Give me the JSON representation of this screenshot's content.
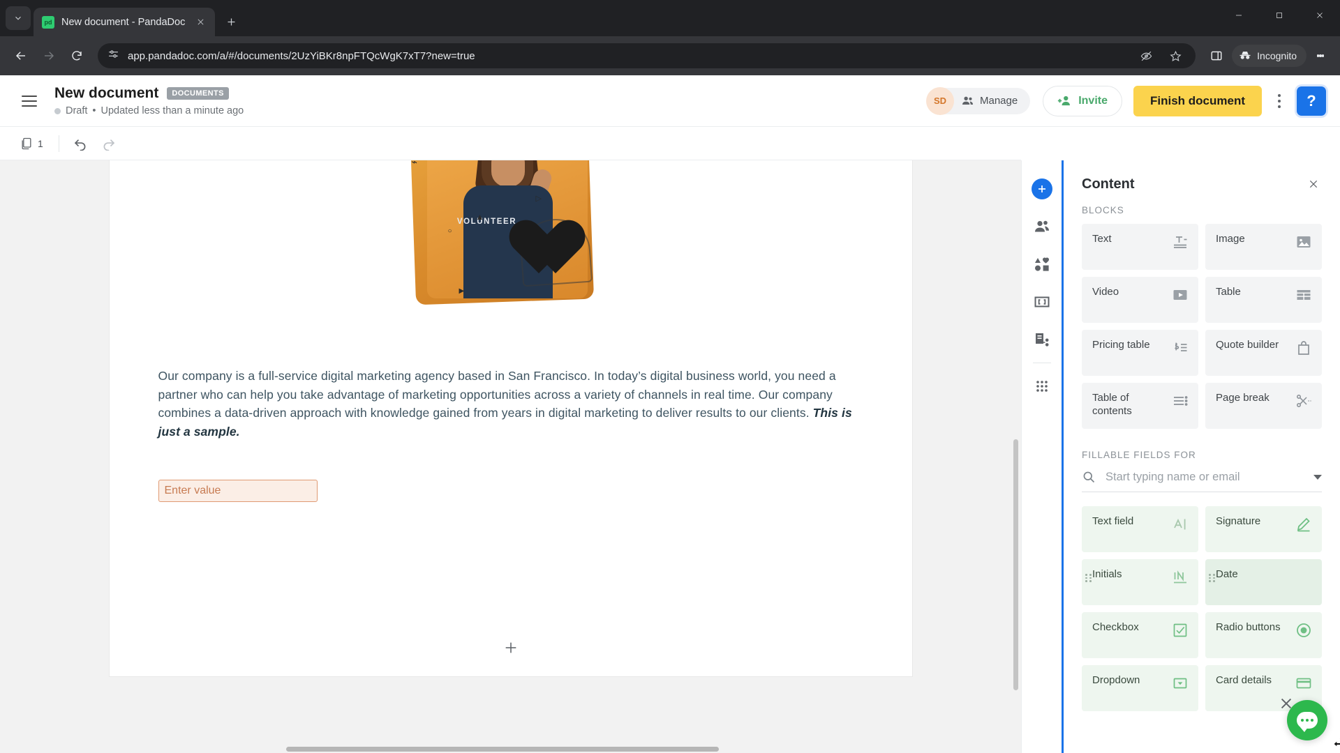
{
  "browser": {
    "tab_title": "New document - PandaDoc",
    "favicon_text": "pd",
    "url": "app.pandadoc.com/a/#/documents/2UzYiBKr8npFTQcWgK7xT7?new=true",
    "profile_label": "Incognito",
    "icons": {
      "tab_search": "chevron-down-icon",
      "close_tab": "close-icon",
      "new_tab": "plus-icon",
      "back": "back-arrow-icon",
      "forward": "forward-arrow-icon",
      "reload": "reload-icon",
      "site_settings": "site-settings-icon",
      "tracking": "eye-off-icon",
      "bookmark": "star-icon",
      "side_panel": "side-panel-icon",
      "menu": "kebab-menu-icon",
      "minimize": "minimize-icon",
      "maximize": "maximize-icon",
      "close_window": "window-close-icon"
    }
  },
  "app_header": {
    "menu_icon": "hamburger-icon",
    "title": "New document",
    "badge": "DOCUMENTS",
    "status": "Draft",
    "separator": "•",
    "updated": "Updated less than a minute ago",
    "avatar_initials": "SD",
    "manage_label": "Manage",
    "invite_label": "Invite",
    "finish_label": "Finish document",
    "help_label": "?"
  },
  "toolbar": {
    "page_count": "1",
    "pages_icon": "pages-icon",
    "undo_icon": "undo-icon",
    "redo_icon": "redo-icon"
  },
  "document": {
    "hero_shirt_text": "VOLUNTEER",
    "paragraph_part1": "Our company is a full-service digital marketing agency based in San Francisco. In today’s digital business world, you need a partner who can help you take advantage of marketing opportunities across a variety of channels in real time. Our company combines a data-driven approach with knowledge gained from years in digital marketing to deliver results to our clients. ",
    "paragraph_emphasis": "This is just a sample.",
    "field_placeholder": "Enter value",
    "add_page_icon": "plus-icon"
  },
  "rail": {
    "items": [
      {
        "name": "add-content",
        "icon": "plus-circle-icon"
      },
      {
        "name": "recipients",
        "icon": "people-icon"
      },
      {
        "name": "content-library",
        "icon": "shapes-icon"
      },
      {
        "name": "variables",
        "icon": "variable-brackets-icon"
      },
      {
        "name": "approval-workflow",
        "icon": "workflow-icon"
      },
      {
        "name": "apps",
        "icon": "grid-dots-icon"
      }
    ]
  },
  "panel": {
    "title": "Content",
    "close_icon": "close-icon",
    "blocks_label": "BLOCKS",
    "blocks": [
      {
        "label": "Text",
        "icon": "text-block-icon"
      },
      {
        "label": "Image",
        "icon": "image-icon"
      },
      {
        "label": "Video",
        "icon": "video-icon"
      },
      {
        "label": "Table",
        "icon": "table-icon"
      },
      {
        "label": "Pricing table",
        "icon": "pricing-table-icon"
      },
      {
        "label": "Quote builder",
        "icon": "quote-builder-icon"
      },
      {
        "label": "Table of contents",
        "icon": "table-of-contents-icon"
      },
      {
        "label": "Page break",
        "icon": "page-break-icon"
      }
    ],
    "fillable_label": "FILLABLE FIELDS FOR",
    "search_placeholder": "Start typing name or email",
    "search_icon": "search-icon",
    "dropdown_icon": "chevron-down-icon",
    "fields": [
      {
        "label": "Text field",
        "icon": "text-field-icon"
      },
      {
        "label": "Signature",
        "icon": "signature-icon"
      },
      {
        "label": "Initials",
        "icon": "initials-icon"
      },
      {
        "label": "Date",
        "icon": "date-icon"
      },
      {
        "label": "Checkbox",
        "icon": "checkbox-icon"
      },
      {
        "label": "Radio buttons",
        "icon": "radio-icon"
      },
      {
        "label": "Dropdown",
        "icon": "dropdown-icon"
      },
      {
        "label": "Card details",
        "icon": "card-details-icon"
      }
    ]
  },
  "chat": {
    "bubble_icon": "chat-bubble-icon",
    "close_icon": "close-icon"
  },
  "colors": {
    "accent_blue": "#1a73e8",
    "finish_yellow": "#fbd34d",
    "invite_green": "#4aa96c",
    "field_orange": "#e09a73",
    "chat_green": "#2db84d"
  }
}
